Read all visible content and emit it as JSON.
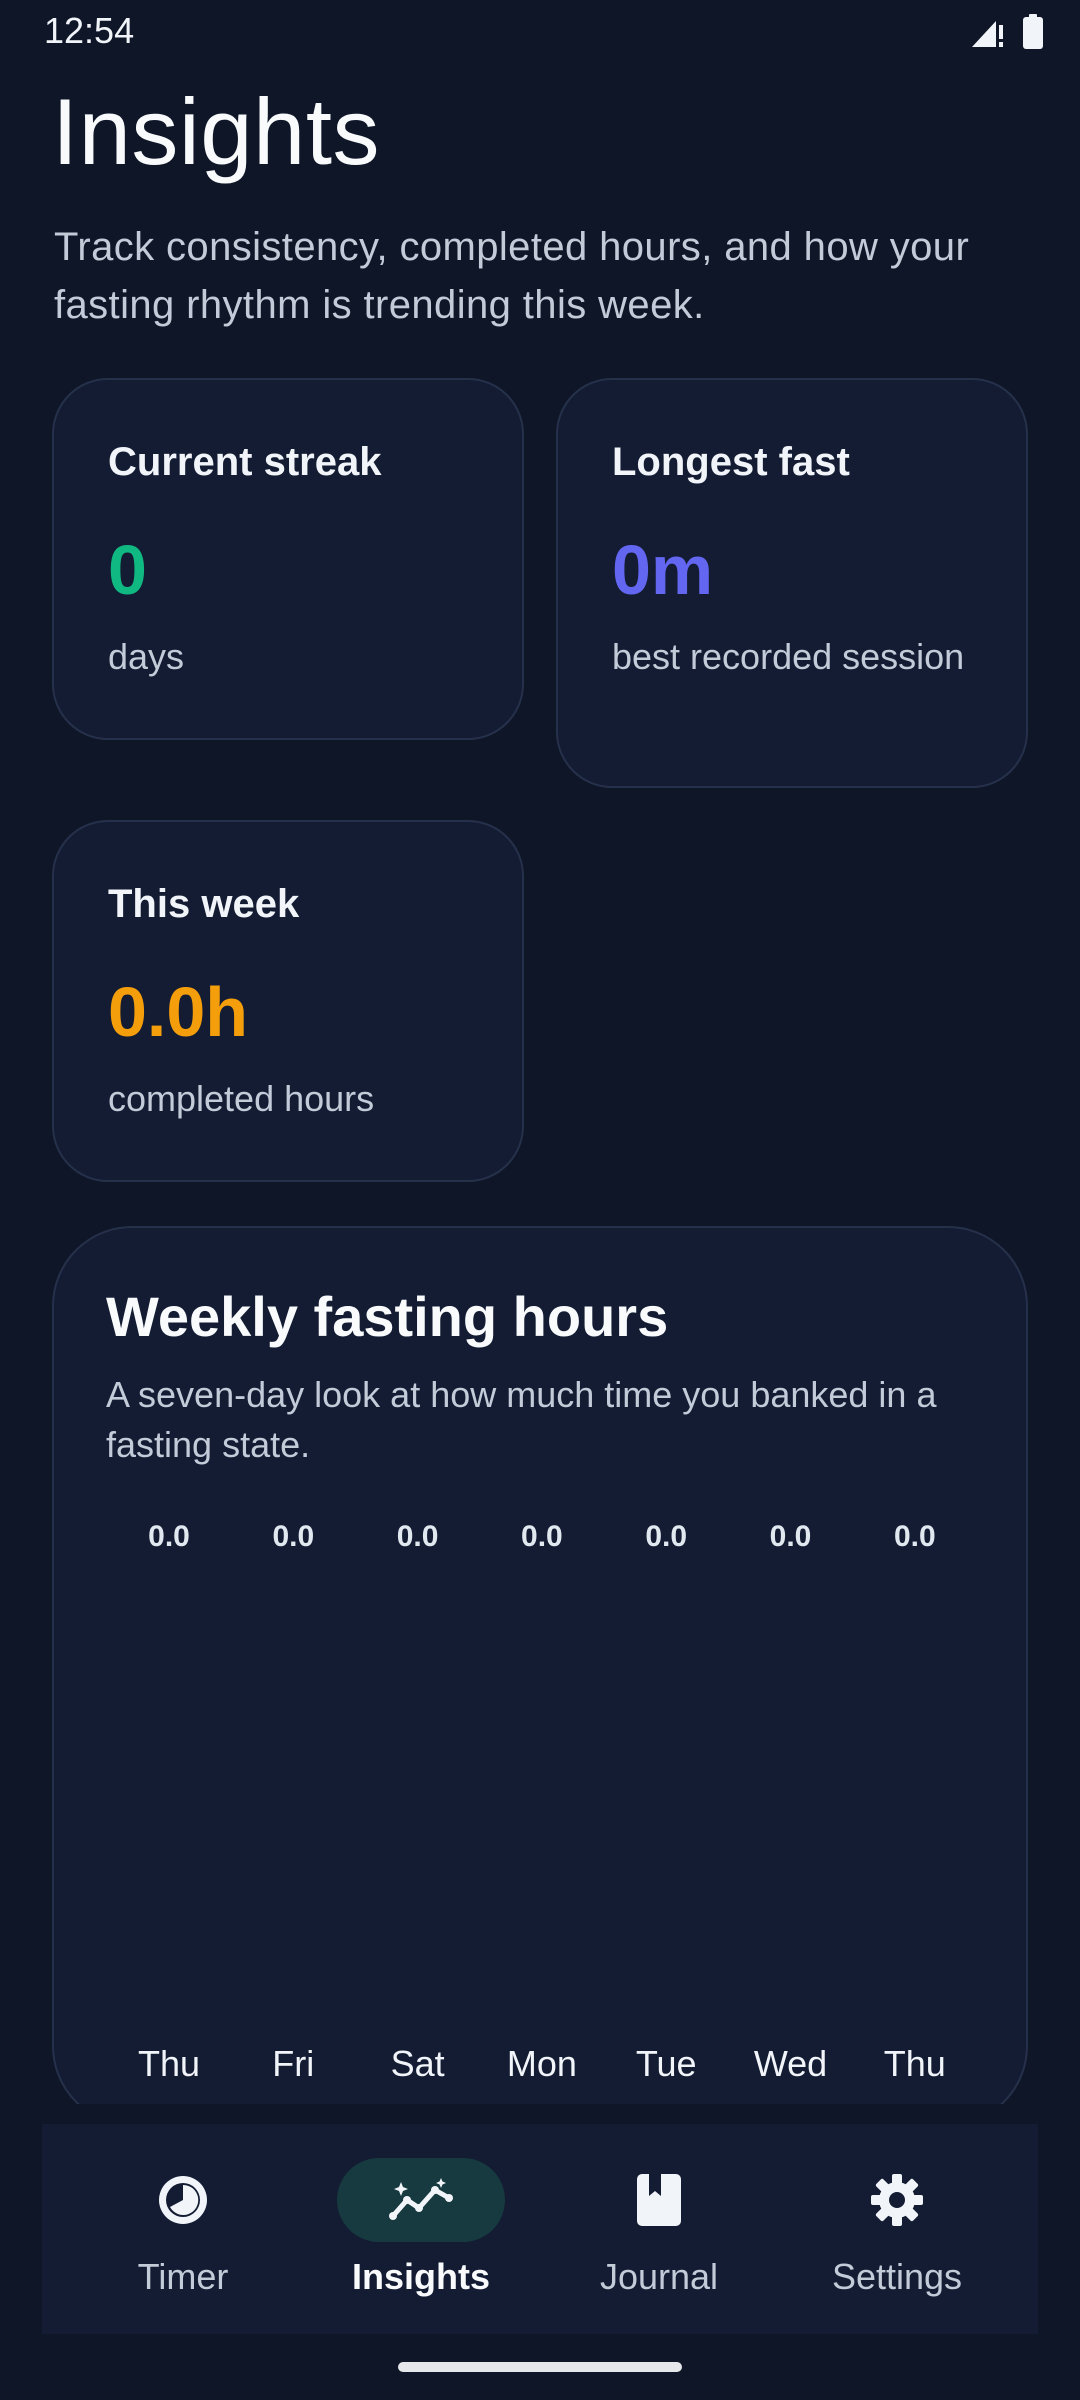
{
  "status_bar": {
    "time": "12:54"
  },
  "header": {
    "title": "Insights",
    "subtitle": "Track consistency, completed hours, and how your fasting rhythm is trending this week."
  },
  "stats": {
    "streak": {
      "title": "Current streak",
      "value": "0",
      "caption": "days",
      "color": "#10b981"
    },
    "longest": {
      "title": "Longest fast",
      "value": "0m",
      "caption": "best recorded session",
      "color": "#6366f1"
    },
    "week": {
      "title": "This week",
      "value": "0.0h",
      "caption": "completed hours",
      "color": "#f59e0b"
    }
  },
  "weekly_chart": {
    "title": "Weekly fasting hours",
    "subtitle": "A seven-day look at how much time you banked in a fasting state."
  },
  "chart_data": {
    "type": "bar",
    "categories": [
      "Thu",
      "Fri",
      "Sat",
      "Mon",
      "Tue",
      "Wed",
      "Thu"
    ],
    "values": [
      0.0,
      0.0,
      0.0,
      0.0,
      0.0,
      0.0,
      0.0
    ],
    "value_labels": [
      "0.0",
      "0.0",
      "0.0",
      "0.0",
      "0.0",
      "0.0",
      "0.0"
    ],
    "title": "Weekly fasting hours",
    "xlabel": "",
    "ylabel": "",
    "grid": false
  },
  "nav": {
    "items": [
      {
        "label": "Timer",
        "icon": "timer-icon",
        "active": false
      },
      {
        "label": "Insights",
        "icon": "insights-icon",
        "active": true
      },
      {
        "label": "Journal",
        "icon": "journal-icon",
        "active": false
      },
      {
        "label": "Settings",
        "icon": "settings-icon",
        "active": false
      }
    ]
  }
}
